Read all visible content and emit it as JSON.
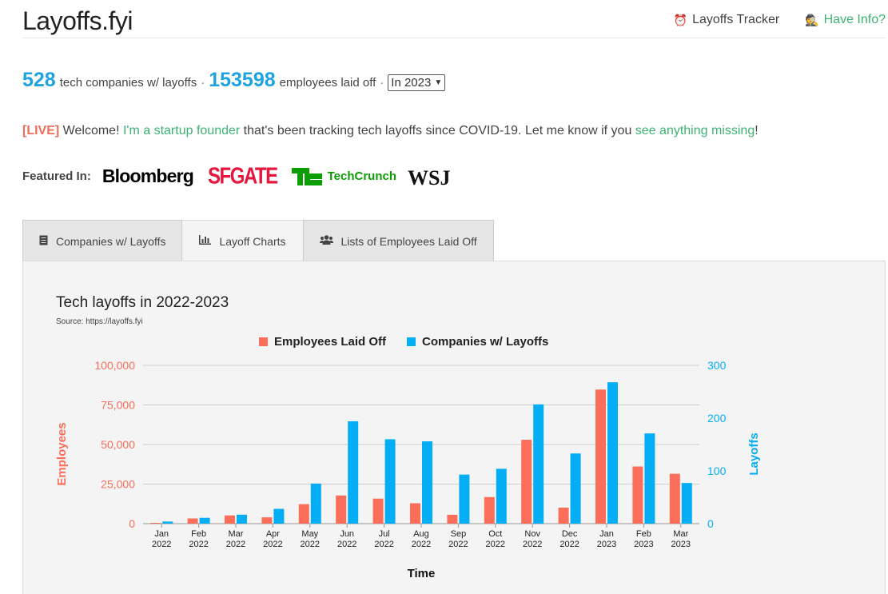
{
  "header": {
    "logo": "Layoffs.fyi",
    "nav": [
      {
        "icon": "alarm-clock-icon",
        "label": "Layoffs Tracker"
      },
      {
        "icon": "spy-icon",
        "label": "Have Info?"
      }
    ]
  },
  "stats": {
    "companies_count": "528",
    "companies_label": "tech companies w/ layoffs",
    "separator": "·",
    "employees_count": "153598",
    "employees_label": "employees laid off",
    "year_select": "In 2023"
  },
  "intro": {
    "live_tag": "[LIVE]",
    "welcome": "Welcome!",
    "founder_link": "I'm a startup founder",
    "middle_text": "that's been tracking tech layoffs since COVID-19. Let me know if you",
    "missing_link": "see anything missing",
    "end": "!"
  },
  "featured": {
    "label": "Featured In:",
    "brands": [
      "Bloomberg",
      "SFGATE",
      "TechCrunch",
      "WSJ"
    ]
  },
  "tabs": [
    {
      "icon": "document-icon",
      "label": "Companies w/ Layoffs",
      "active": false
    },
    {
      "icon": "bar-chart-icon",
      "label": "Layoff Charts",
      "active": true
    },
    {
      "icon": "users-icon",
      "label": "Lists of Employees Laid Off",
      "active": false
    }
  ],
  "chart_data": {
    "type": "bar",
    "title": "Tech layoffs in 2022-2023",
    "subtitle": "Source: https://layoffs.fyi",
    "xlabel": "Time",
    "categories": [
      [
        "Jan",
        "2022"
      ],
      [
        "Feb",
        "2022"
      ],
      [
        "Mar",
        "2022"
      ],
      [
        "Apr",
        "2022"
      ],
      [
        "May",
        "2022"
      ],
      [
        "Jun",
        "2022"
      ],
      [
        "Jul",
        "2022"
      ],
      [
        "Aug",
        "2022"
      ],
      [
        "Sep",
        "2022"
      ],
      [
        "Oct",
        "2022"
      ],
      [
        "Nov",
        "2022"
      ],
      [
        "Dec",
        "2022"
      ],
      [
        "Jan",
        "2023"
      ],
      [
        "Feb",
        "2023"
      ],
      [
        "Mar",
        "2023"
      ]
    ],
    "series": [
      {
        "name": "Employees Laid Off",
        "axis": "left",
        "color": "#fa6e5a",
        "values": [
          500,
          3300,
          5200,
          4000,
          12300,
          17800,
          15800,
          12900,
          5600,
          16800,
          53000,
          10100,
          84700,
          36100,
          31500
        ]
      },
      {
        "name": "Companies w/ Layoffs",
        "axis": "right",
        "color": "#04aef4",
        "values": [
          4,
          11,
          17,
          28,
          76,
          194,
          160,
          156,
          93,
          104,
          226,
          133,
          268,
          171,
          77
        ]
      }
    ],
    "left_axis": {
      "label": "Employees",
      "color": "#fa6e5a",
      "ylim": [
        0,
        100000
      ],
      "ticks": [
        "0",
        "25,000",
        "50,000",
        "75,000",
        "100,000"
      ],
      "tick_values": [
        0,
        25000,
        50000,
        75000,
        100000
      ]
    },
    "right_axis": {
      "label": "Layoffs",
      "color": "#04aef4",
      "ylim": [
        0,
        300
      ],
      "ticks": [
        "0",
        "100",
        "200",
        "300"
      ],
      "tick_values": [
        0,
        100,
        200,
        300
      ]
    },
    "grid": true,
    "legend_position": "top-center"
  }
}
